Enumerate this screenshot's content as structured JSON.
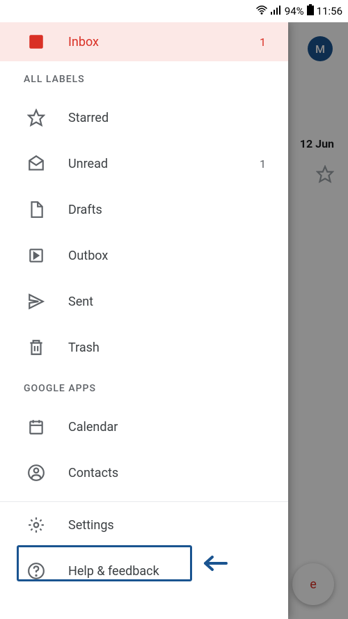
{
  "status_bar": {
    "battery_pct": "94%",
    "time": "11:56"
  },
  "background": {
    "avatar_letter": "M",
    "date_label": "12 Jun",
    "fab_label": "e"
  },
  "drawer": {
    "inbox": {
      "label": "Inbox",
      "count": "1"
    },
    "sections": {
      "all_labels": "ALL LABELS",
      "google_apps": "GOOGLE APPS"
    },
    "items": {
      "starred": "Starred",
      "unread": "Unread",
      "unread_count": "1",
      "drafts": "Drafts",
      "outbox": "Outbox",
      "sent": "Sent",
      "trash": "Trash",
      "calendar": "Calendar",
      "contacts": "Contacts",
      "settings": "Settings",
      "help": "Help & feedback"
    }
  }
}
